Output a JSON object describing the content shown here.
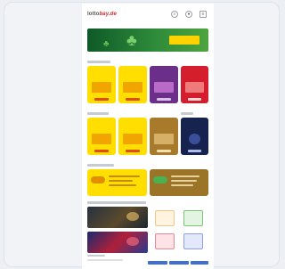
{
  "header": {
    "logo_left": "lotto",
    "logo_mid": "bay.de",
    "logo_tail": "",
    "icons": [
      "search-icon",
      "user-icon",
      "menu-icon"
    ]
  },
  "hero": {
    "tag": "",
    "colors": {
      "start": "#0f5a28",
      "end": "#4ea43e",
      "tag": "#ffd200"
    }
  },
  "tiles_row1": [
    {
      "title": "",
      "color": "#ffde00"
    },
    {
      "title": "",
      "color": "#ffde00"
    },
    {
      "title": "",
      "color": "#6b2f8a"
    },
    {
      "title": "",
      "color": "#d41e2e"
    }
  ],
  "tiles_row2": [
    {
      "title": "",
      "color": "#ffde00"
    },
    {
      "title": "",
      "color": "#ffde00"
    },
    {
      "title": "",
      "color": "#a87a2c"
    },
    {
      "title": "",
      "color": "#17234f"
    }
  ],
  "wide_tiles": [
    {
      "title": "",
      "color": "#ffde00"
    },
    {
      "title": "",
      "color": "#9c7428"
    }
  ]
}
